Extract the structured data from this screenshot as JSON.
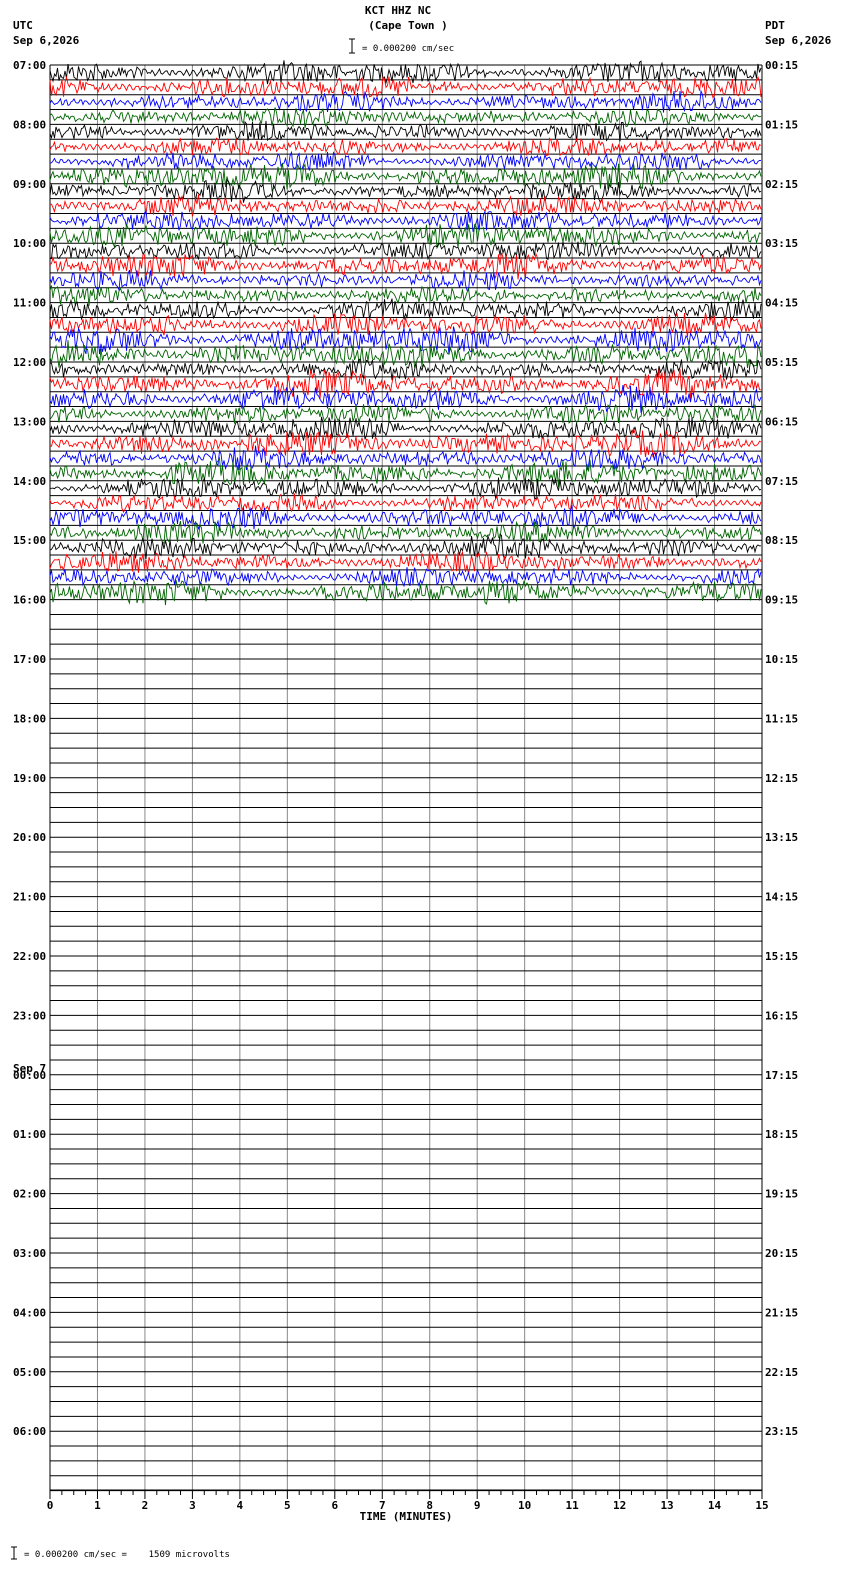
{
  "header": {
    "station": "KCT HHZ NC",
    "location": "(Cape Town )",
    "scale_label": "= 0.000200 cm/sec",
    "left_tz": "UTC",
    "left_date": "Sep 6,2026",
    "right_tz": "PDT",
    "right_date": "Sep 6,2026",
    "day_change_label": "Sep 7"
  },
  "footer": {
    "scale_note": "= 0.000200 cm/sec =    1509 microvolts"
  },
  "colors": {
    "trace_cycle": [
      "#000000",
      "#ff0000",
      "#0000ff",
      "#006400"
    ],
    "grid": "#000000",
    "minute_grid": "#888888"
  },
  "chart_data": {
    "type": "line",
    "title": "KCT HHZ NC (Cape Town )",
    "xlabel": "TIME (MINUTES)",
    "xlim": [
      0,
      15
    ],
    "x_ticks": [
      "0",
      "1",
      "2",
      "3",
      "4",
      "5",
      "6",
      "7",
      "8",
      "9",
      "10",
      "11",
      "12",
      "13",
      "14",
      "15"
    ],
    "traces_per_hour": 4,
    "total_lines": 96,
    "recorded_lines": 36,
    "utc_hour_labels": [
      "07:00",
      "08:00",
      "09:00",
      "10:00",
      "11:00",
      "12:00",
      "13:00",
      "14:00",
      "15:00",
      "16:00",
      "17:00",
      "18:00",
      "19:00",
      "20:00",
      "21:00",
      "22:00",
      "23:00",
      "00:00",
      "01:00",
      "02:00",
      "03:00",
      "04:00",
      "05:00",
      "06:00"
    ],
    "pdt_hour_labels": [
      "00:15",
      "01:15",
      "02:15",
      "03:15",
      "04:15",
      "05:15",
      "06:15",
      "07:15",
      "08:15",
      "09:15",
      "10:15",
      "11:15",
      "12:15",
      "13:15",
      "14:15",
      "15:15",
      "16:15",
      "17:15",
      "18:15",
      "19:15",
      "20:15",
      "21:15",
      "22:15",
      "23:15"
    ],
    "grid": true
  }
}
